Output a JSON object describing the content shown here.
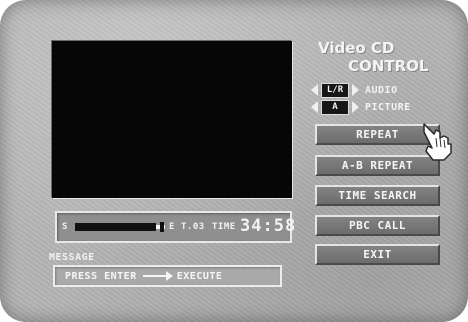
{
  "header": {
    "title_line1": "Video CD",
    "title_line2": "CONTROL"
  },
  "selectors": [
    {
      "value": "L/R",
      "label": "AUDIO"
    },
    {
      "value": "A",
      "label": "PICTURE"
    }
  ],
  "menu": {
    "items": [
      "REPEAT",
      "A-B REPEAT",
      "TIME SEARCH",
      "PBC CALL",
      "EXIT"
    ],
    "highlighted": "REPEAT"
  },
  "status": {
    "start_label": "S",
    "end_label": "E",
    "track": "T.03",
    "time_label": "TIME",
    "time_value": "34:58",
    "progress": 0.9
  },
  "message": {
    "title": "MESSAGE",
    "text_left": "PRESS ENTER",
    "text_right": "EXECUTE"
  },
  "icons": {
    "cursor": "pointing-hand-icon",
    "selector_left": "triangle-left-icon",
    "selector_right": "triangle-right-icon",
    "message_arrow": "long-right-arrow-icon"
  },
  "colors": {
    "panel": "#b4b4b4",
    "button": "#777777",
    "text": "#f4f4f4",
    "video": "#060606"
  }
}
